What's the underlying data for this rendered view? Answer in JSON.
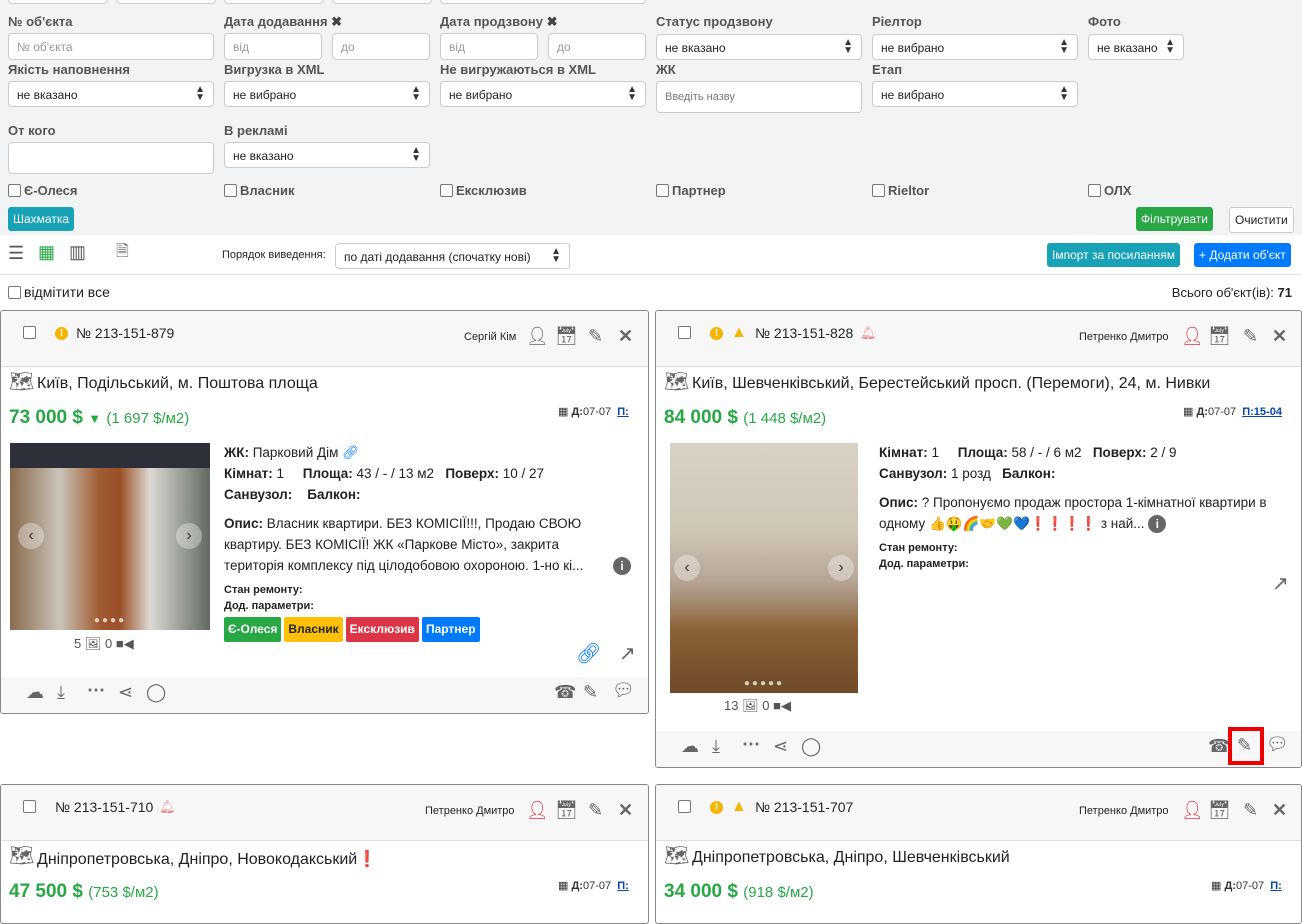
{
  "filters": {
    "object_no": {
      "label": "№ об'єкта",
      "placeholder": "№ об'єкта"
    },
    "date_added": {
      "label": "Дата додавання",
      "from": "від",
      "to": "до"
    },
    "date_call": {
      "label": "Дата продзвону",
      "from": "від",
      "to": "до"
    },
    "call_status": {
      "label": "Статус продзвону",
      "value": "не вказано"
    },
    "realtor": {
      "label": "Ріелтор",
      "value": "не вибрано"
    },
    "photo": {
      "label": "Фото",
      "value": "не вказано"
    },
    "fill_quality": {
      "label": "Якість наповнення",
      "value": "не вказано"
    },
    "xml_export": {
      "label": "Вигрузка в XML",
      "value": "не вибрано"
    },
    "no_xml": {
      "label": "Не вигружаються в XML",
      "value": "не вибрано"
    },
    "complex": {
      "label": "ЖК",
      "placeholder": "Введіть назву"
    },
    "stage": {
      "label": "Етап",
      "value": "не вибрано"
    },
    "from_whom": {
      "label": "От кого",
      "value": ""
    },
    "in_ads": {
      "label": "В рекламі",
      "value": "не вказано"
    },
    "checkboxes": [
      "Є-Олеся",
      "Власник",
      "Ексклюзив",
      "Партнер",
      "Rieltor",
      "ОЛХ"
    ],
    "chess_button": "Шахматка",
    "filter_button": "Фільтрувати",
    "clear_button": "Очистити",
    "clear_icon": "✖"
  },
  "toolbar": {
    "order_label": "Порядок виведення:",
    "order_value": "по даті додавання (спочатку нові)",
    "import_button": "Імпорт за посиланням",
    "add_button": "+ Додати об'єкт",
    "select_all": "відмітити все",
    "total_label": "Всього об'єкт(ів):",
    "total": "71"
  },
  "colors": {
    "green": "#28a745",
    "teal": "#17a2b8",
    "blue": "#007bff",
    "red": "#dc3545",
    "yellow": "#ffc107"
  },
  "cards": [
    {
      "id": "№ 213-151-879",
      "agent": "Сергій Кім",
      "address": "Київ, Подільський, м. Поштова площа",
      "price": "73 000 $",
      "per_m2": "(1 697 $/м2)",
      "date_d": "Д:",
      "date_d_val": "07-07",
      "date_p": "П:",
      "zk_label": "ЖК:",
      "zk": "Парковий Дім",
      "rooms_label": "Кімнат:",
      "rooms": "1",
      "area_label": "Площа:",
      "area": "43 / - / 13 м2",
      "floor_label": "Поверх:",
      "floor": "10 / 27",
      "bath_label": "Санвузол:",
      "bath": "",
      "balcony_label": "Балкон:",
      "desc_label": "Опис:",
      "desc": "Власник квартири. БЕЗ КОМІСІЇ!!!, Продаю СВОЮ квартиру. БЕЗ КОМІСІЇ! ЖК «Паркове Місто», закрита територія комплексу під цілодобовою охороною. 1-но кі...",
      "repair_label": "Стан ремонту:",
      "params_label": "Дод. параметри:",
      "photos": "5",
      "videos": "0",
      "tags": [
        "Є-Олеся",
        "Власник",
        "Ексклюзив",
        "Партнер"
      ]
    },
    {
      "id": "№ 213-151-828",
      "agent": "Петренко Дмитро",
      "address": "Київ, Шевченківський, Берестейський просп. (Перемоги), 24, м. Нивки",
      "price": "84 000 $",
      "per_m2": "(1 448 $/м2)",
      "date_d": "Д:",
      "date_d_val": "07-07",
      "date_p": "П:15-04",
      "rooms_label": "Кімнат:",
      "rooms": "1",
      "area_label": "Площа:",
      "area": "58 / - / 6 м2",
      "floor_label": "Поверх:",
      "floor": "2 / 9",
      "bath_label": "Санвузол:",
      "bath": "1 розд",
      "balcony_label": "Балкон:",
      "desc_label": "Опис:",
      "desc": "? Пропонуємо продаж простора 1-кімнатної квартири в одному 👍🤑🌈🤝💚💙❗❗❗❗ з най...",
      "repair_label": "Стан ремонту:",
      "params_label": "Дод. параметри:",
      "photos": "13",
      "videos": "0"
    },
    {
      "id": "№ 213-151-710",
      "agent": "Петренко Дмитро",
      "address": "Дніпропетровська, Дніпро, Новокодакський",
      "address_mark": "❗",
      "price": "47 500 $",
      "per_m2": "(753 $/м2)",
      "date_d": "Д:",
      "date_d_val": "07-07",
      "date_p": "П:"
    },
    {
      "id": "№ 213-151-707",
      "agent": "Петренко Дмитро",
      "address": "Дніпропетровська, Дніпро, Шевченківський",
      "price": "34 000 $",
      "per_m2": "(918 $/м2)",
      "date_d": "Д:",
      "date_d_val": "07-07",
      "date_p": "П:"
    }
  ]
}
